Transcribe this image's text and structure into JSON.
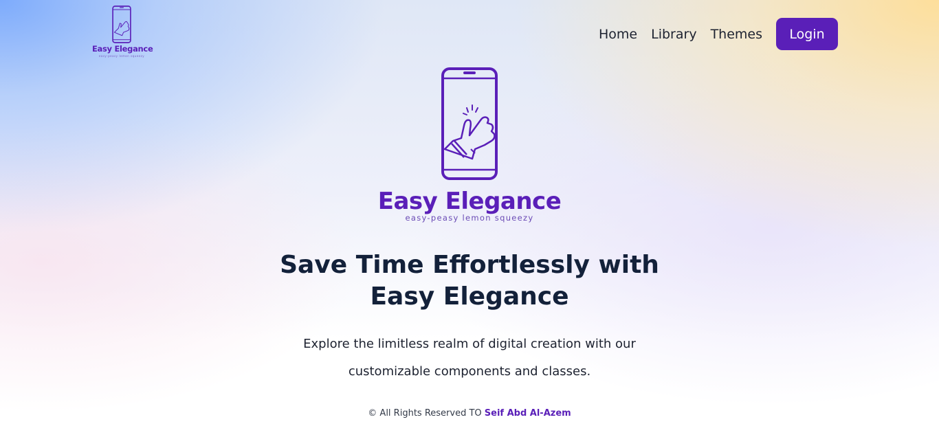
{
  "colors": {
    "brand": "#5a1fb8",
    "headline": "#13213a",
    "text": "#1d2230"
  },
  "header": {
    "logo": {
      "icon": "phone-hand-icon",
      "name": "Easy Elegance",
      "tagline": "easy-peasy lemon squeezy"
    },
    "nav": {
      "home": "Home",
      "library": "Library",
      "themes": "Themes",
      "login": "Login"
    }
  },
  "hero": {
    "icon": "phone-hand-icon",
    "brand_name": "Easy Elegance",
    "brand_tagline": "easy-peasy lemon squeezy",
    "headline_line1": "Save Time Effortlessly with",
    "headline_line2": "Easy Elegance",
    "subtext_line1": "Explore the limitless realm of digital creation with our",
    "subtext_line2": "customizable components and classes."
  },
  "footer": {
    "rights": "© All Rights Reserved TO ",
    "author": "Seif Abd Al-Azem"
  }
}
